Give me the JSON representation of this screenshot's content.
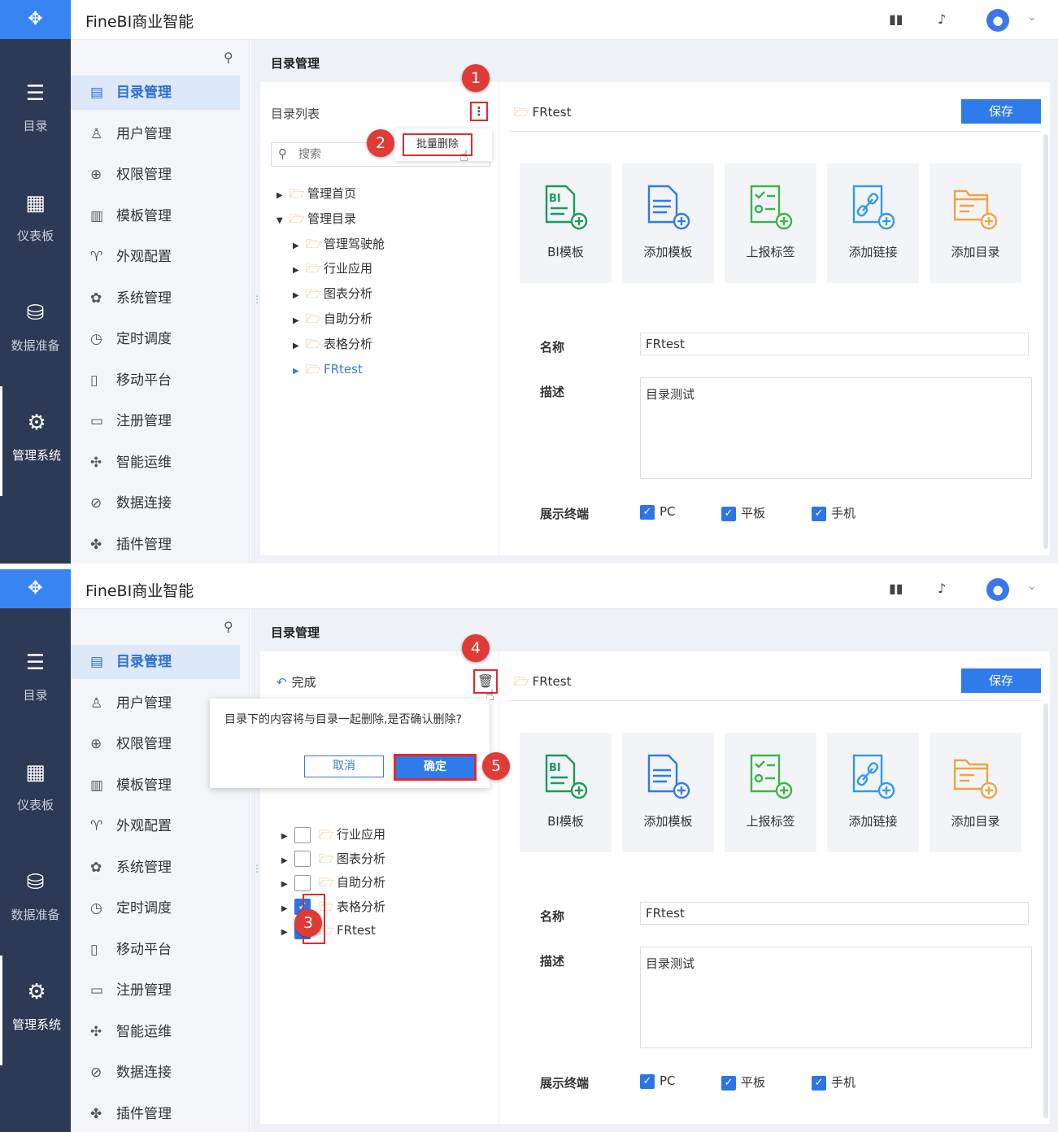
{
  "app": {
    "brand": "FineBI商业智能"
  },
  "rail": {
    "items": [
      {
        "label": "目录",
        "icon": "list-icon"
      },
      {
        "label": "仪表板",
        "icon": "dashboard-icon"
      },
      {
        "label": "数据准备",
        "icon": "database-icon"
      },
      {
        "label": "管理系统",
        "icon": "gear-icon",
        "active": true
      }
    ]
  },
  "topbar": {
    "icons": [
      "book-icon",
      "bell-icon",
      "user-avatar"
    ]
  },
  "menu": {
    "items": [
      {
        "label": "目录管理",
        "icon": "directory-icon",
        "active": true
      },
      {
        "label": "用户管理",
        "icon": "user-icon"
      },
      {
        "label": "权限管理",
        "icon": "lock-icon"
      },
      {
        "label": "模板管理",
        "icon": "template-icon"
      },
      {
        "label": "外观配置",
        "icon": "brush-icon"
      },
      {
        "label": "系统管理",
        "icon": "settings-icon"
      },
      {
        "label": "定时调度",
        "icon": "timer-icon"
      },
      {
        "label": "移动平台",
        "icon": "mobile-icon"
      },
      {
        "label": "注册管理",
        "icon": "register-icon"
      },
      {
        "label": "智能运维",
        "icon": "ops-icon"
      },
      {
        "label": "数据连接",
        "icon": "link-icon"
      },
      {
        "label": "插件管理",
        "icon": "plugin-icon"
      }
    ]
  },
  "page": {
    "title": "目录管理"
  },
  "left_panel": {
    "header": "目录列表",
    "search_placeholder": "搜索",
    "batch_delete": "批量删除",
    "tree": [
      {
        "label": "管理首页",
        "level": 0,
        "expanded": false
      },
      {
        "label": "管理目录",
        "level": 0,
        "expanded": true
      },
      {
        "label": "管理驾驶舱",
        "level": 1
      },
      {
        "label": "行业应用",
        "level": 1
      },
      {
        "label": "图表分析",
        "level": 1
      },
      {
        "label": "自助分析",
        "level": 1
      },
      {
        "label": "表格分析",
        "level": 1
      },
      {
        "label": "FRtest",
        "level": 1,
        "selected": true
      }
    ]
  },
  "left_panel_batch": {
    "done_label": "完成",
    "confirm_message": "目录下的内容将与目录一起删除,是否确认删除?",
    "cancel_label": "取消",
    "ok_label": "确定",
    "rows": [
      {
        "label": "行业应用",
        "checked": false
      },
      {
        "label": "图表分析",
        "checked": false
      },
      {
        "label": "自助分析",
        "checked": false
      },
      {
        "label": "表格分析",
        "checked": true
      },
      {
        "label": "FRtest",
        "checked": true
      }
    ]
  },
  "right_panel": {
    "folder_name": "FRtest",
    "save_label": "保存",
    "cards": [
      {
        "label": "BI模板",
        "color": "#1a9b5c"
      },
      {
        "label": "添加模板",
        "color": "#2f7be9"
      },
      {
        "label": "上报标签",
        "color": "#39b54a"
      },
      {
        "label": "添加链接",
        "color": "#2f9be9"
      },
      {
        "label": "添加目录",
        "color": "#f0a340"
      }
    ],
    "name_label": "名称",
    "name_value": "FRtest",
    "desc_label": "描述",
    "desc_value": "目录测试",
    "terminal_label": "展示终端",
    "terminals": [
      {
        "label": "PC",
        "checked": true
      },
      {
        "label": "平板",
        "checked": true
      },
      {
        "label": "手机",
        "checked": true
      }
    ]
  },
  "badges": [
    "1",
    "2",
    "3",
    "4",
    "5"
  ],
  "colors": {
    "rail": "#2d3a55",
    "accent": "#2f7be9",
    "highlight": "#e02b2b",
    "badge": "#e03b36",
    "folder": "#f0a340"
  }
}
